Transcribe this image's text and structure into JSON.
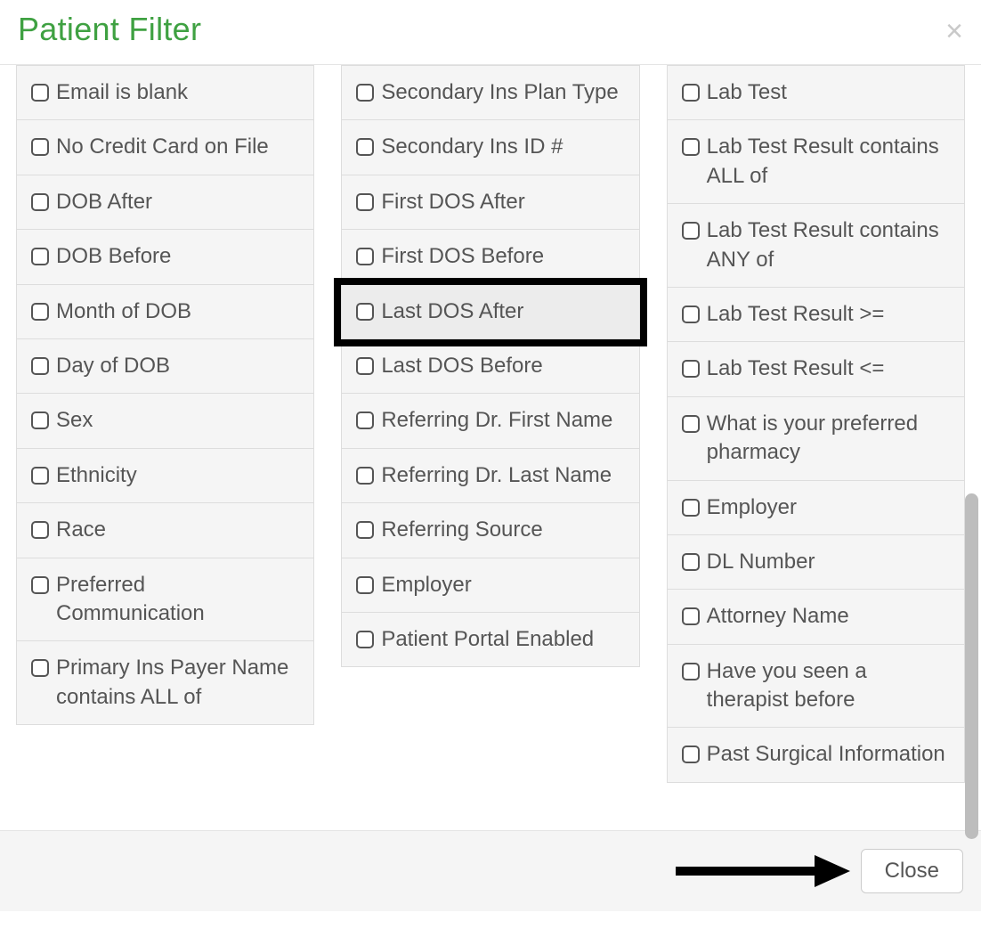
{
  "header": {
    "title": "Patient Filter",
    "close_glyph": "×"
  },
  "columns": {
    "left": [
      {
        "label": "Email is blank"
      },
      {
        "label": "No Credit Card on File"
      },
      {
        "label": "DOB After"
      },
      {
        "label": "DOB Before"
      },
      {
        "label": "Month of DOB"
      },
      {
        "label": "Day of DOB"
      },
      {
        "label": "Sex"
      },
      {
        "label": "Ethnicity"
      },
      {
        "label": "Race"
      },
      {
        "label": "Preferred Communication"
      },
      {
        "label": "Primary Ins Payer Name contains ALL of"
      }
    ],
    "middle": [
      {
        "label": "Secondary Ins Plan Type"
      },
      {
        "label": "Secondary Ins ID #"
      },
      {
        "label": "First DOS After"
      },
      {
        "label": "First DOS Before"
      },
      {
        "label": "Last DOS After",
        "highlight": true
      },
      {
        "label": "Last DOS Before"
      },
      {
        "label": "Referring Dr. First Name"
      },
      {
        "label": "Referring Dr. Last Name"
      },
      {
        "label": "Referring Source"
      },
      {
        "label": "Employer"
      },
      {
        "label": "Patient Portal Enabled"
      }
    ],
    "right": [
      {
        "label": "Lab Test"
      },
      {
        "label": "Lab Test Result contains ALL of"
      },
      {
        "label": "Lab Test Result contains ANY of"
      },
      {
        "label": "Lab Test Result >="
      },
      {
        "label": "Lab Test Result <="
      },
      {
        "label": "What is your preferred pharmacy"
      },
      {
        "label": "Employer"
      },
      {
        "label": "DL Number"
      },
      {
        "label": "Attorney Name"
      },
      {
        "label": "Have you seen a therapist before"
      },
      {
        "label": "Past Surgical Information"
      }
    ]
  },
  "footer": {
    "close_label": "Close"
  }
}
